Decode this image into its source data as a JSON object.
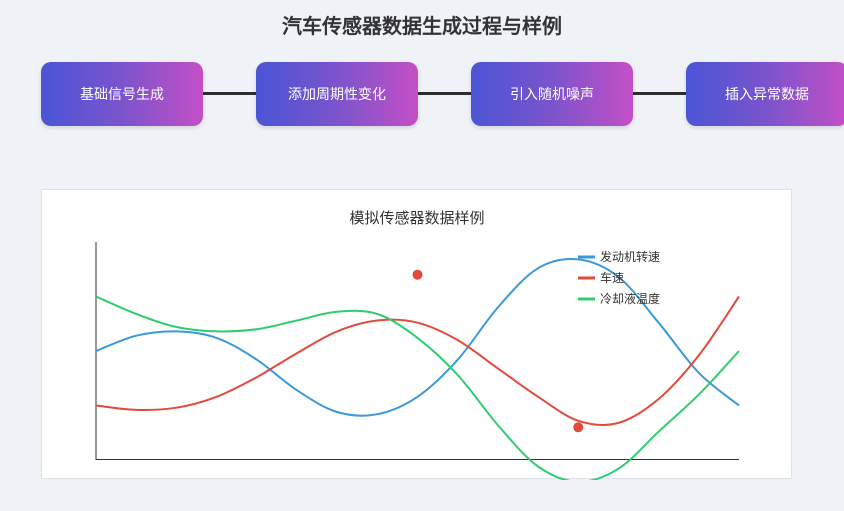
{
  "header": {
    "title": "汽车传感器数据生成过程与样例"
  },
  "flow": {
    "steps": [
      {
        "label": "基础信号生成"
      },
      {
        "label": "添加周期性变化"
      },
      {
        "label": "引入随机噪声"
      },
      {
        "label": "插入异常数据"
      }
    ],
    "gradient_colors": [
      "#4a55d6",
      "#c44fc6"
    ]
  },
  "chart_data": {
    "type": "line",
    "title": "模拟传感器数据样例",
    "xlabel": "",
    "ylabel": "",
    "xlim": [
      0,
      120
    ],
    "ylim": [
      0,
      100
    ],
    "grid": false,
    "legend_position": "top-right",
    "series": [
      {
        "name": "发动机转速",
        "color": "#3a9ad9",
        "x": [
          0,
          7.5,
          15,
          22.5,
          30,
          37.5,
          45,
          52.5,
          60,
          67.5,
          75,
          82.5,
          90,
          97.5,
          105,
          112.5,
          120
        ],
        "values": [
          50,
          57,
          59,
          56,
          46,
          32,
          22,
          21,
          29,
          46,
          70,
          88,
          92,
          84,
          63,
          40,
          25
        ]
      },
      {
        "name": "车速",
        "color": "#e24a3b",
        "x": [
          0,
          7.5,
          15,
          22.5,
          30,
          37.5,
          45,
          52.5,
          60,
          67.5,
          75,
          82.5,
          90,
          97.5,
          105,
          112.5,
          120
        ],
        "values": [
          25,
          23,
          24,
          29,
          38,
          49,
          59,
          64,
          63,
          55,
          42,
          29,
          18,
          17,
          28,
          48,
          75
        ]
      },
      {
        "name": "冷却液温度",
        "color": "#2ecc71",
        "x": [
          0,
          7.5,
          15,
          22.5,
          30,
          37.5,
          45,
          52.5,
          60,
          67.5,
          75,
          82.5,
          90,
          97.5,
          105,
          112.5,
          120
        ],
        "values": [
          75,
          67,
          61,
          59,
          60,
          64,
          68,
          67,
          56,
          39,
          16,
          -3,
          -10,
          -4,
          13,
          30,
          50
        ]
      }
    ],
    "anomalies": [
      {
        "x": 60,
        "y": 85,
        "color": "#e24a3b"
      },
      {
        "x": 90,
        "y": 15,
        "color": "#e24a3b"
      }
    ]
  }
}
